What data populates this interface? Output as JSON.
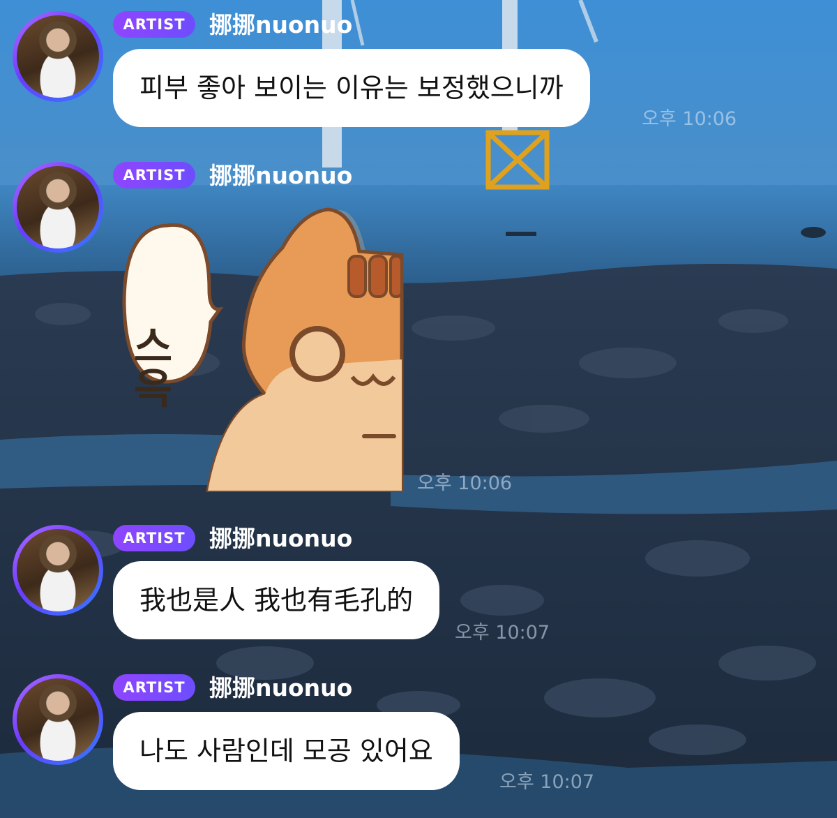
{
  "messages": [
    {
      "badge": "ARTIST",
      "name": "挪挪nuonuo",
      "text": "피부 좋아 보이는 이유는 보정했으니까",
      "time": "오후 10:06"
    },
    {
      "badge": "ARTIST",
      "name": "挪挪nuonuo",
      "sticker_text": "스윽",
      "time": "오후 10:06"
    },
    {
      "badge": "ARTIST",
      "name": "挪挪nuonuo",
      "text": "我也是人 我也有毛孔的",
      "time": "오후 10:07"
    },
    {
      "badge": "ARTIST",
      "name": "挪挪nuonuo",
      "text": "나도 사람인데 모공 있어요",
      "time": "오후 10:07"
    }
  ],
  "icons": [
    "avatar-photo",
    "cat-sticker"
  ],
  "colors": {
    "badge_gradient_start": "#8f45ff",
    "badge_gradient_end": "#6e4dff",
    "bubble": "#ffffff",
    "sky": "#3d86c9",
    "sea": "#2b6ea8"
  }
}
